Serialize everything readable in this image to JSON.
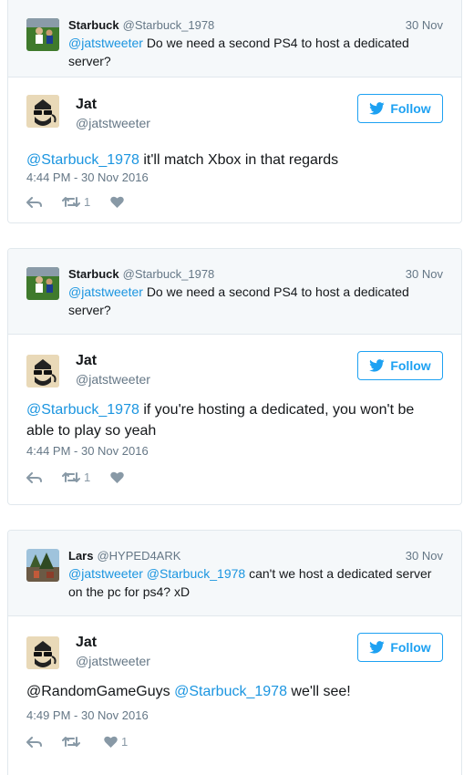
{
  "threads": [
    {
      "parent": {
        "name": "Starbuck",
        "handle": "@Starbuck_1978",
        "date": "30 Nov",
        "mention": "@jatstweeter",
        "text": "Do we need a second PS4 to host a dedicated server?"
      },
      "reply": {
        "name": "Jat",
        "handle": "@jatstweeter",
        "follow_label": "Follow",
        "mentions": [
          "@Starbuck_1978"
        ],
        "text": "it'll match Xbox in that regards",
        "timestamp": "4:44 PM - 30 Nov 2016",
        "retweet_count": "1",
        "like_count": ""
      }
    },
    {
      "parent": {
        "name": "Starbuck",
        "handle": "@Starbuck_1978",
        "date": "30 Nov",
        "mention": "@jatstweeter",
        "text": "Do we need a second PS4 to host a dedicated server?"
      },
      "reply": {
        "name": "Jat",
        "handle": "@jatstweeter",
        "follow_label": "Follow",
        "mentions": [
          "@Starbuck_1978"
        ],
        "text": "if you're hosting a dedicated, you won't be able to play so yeah",
        "timestamp": "4:44 PM - 30 Nov 2016",
        "retweet_count": "1",
        "like_count": ""
      }
    },
    {
      "parent": {
        "name": "Lars",
        "handle": "@HYPED4ARK",
        "date": "30 Nov",
        "mention": "@jatstweeter @Starbuck_1978",
        "text": "can't we host a dedicated server on the pc for ps4? xD"
      },
      "reply": {
        "name": "Jat",
        "handle": "@jatstweeter",
        "follow_label": "Follow",
        "prefix": "@RandomGameGuys",
        "mentions": [
          "@Starbuck_1978"
        ],
        "text": "we'll see!",
        "timestamp": "4:49 PM - 30 Nov 2016",
        "retweet_count": "",
        "like_count": "1"
      }
    }
  ],
  "colors": {
    "link": "#1b95e0",
    "follow": "#1da1f2",
    "muted": "#657786",
    "border": "#e1e8ed",
    "parent_bg": "#f5f8fa"
  },
  "icons": [
    "reply-icon",
    "retweet-icon",
    "heart-icon",
    "twitter-bird-icon"
  ]
}
